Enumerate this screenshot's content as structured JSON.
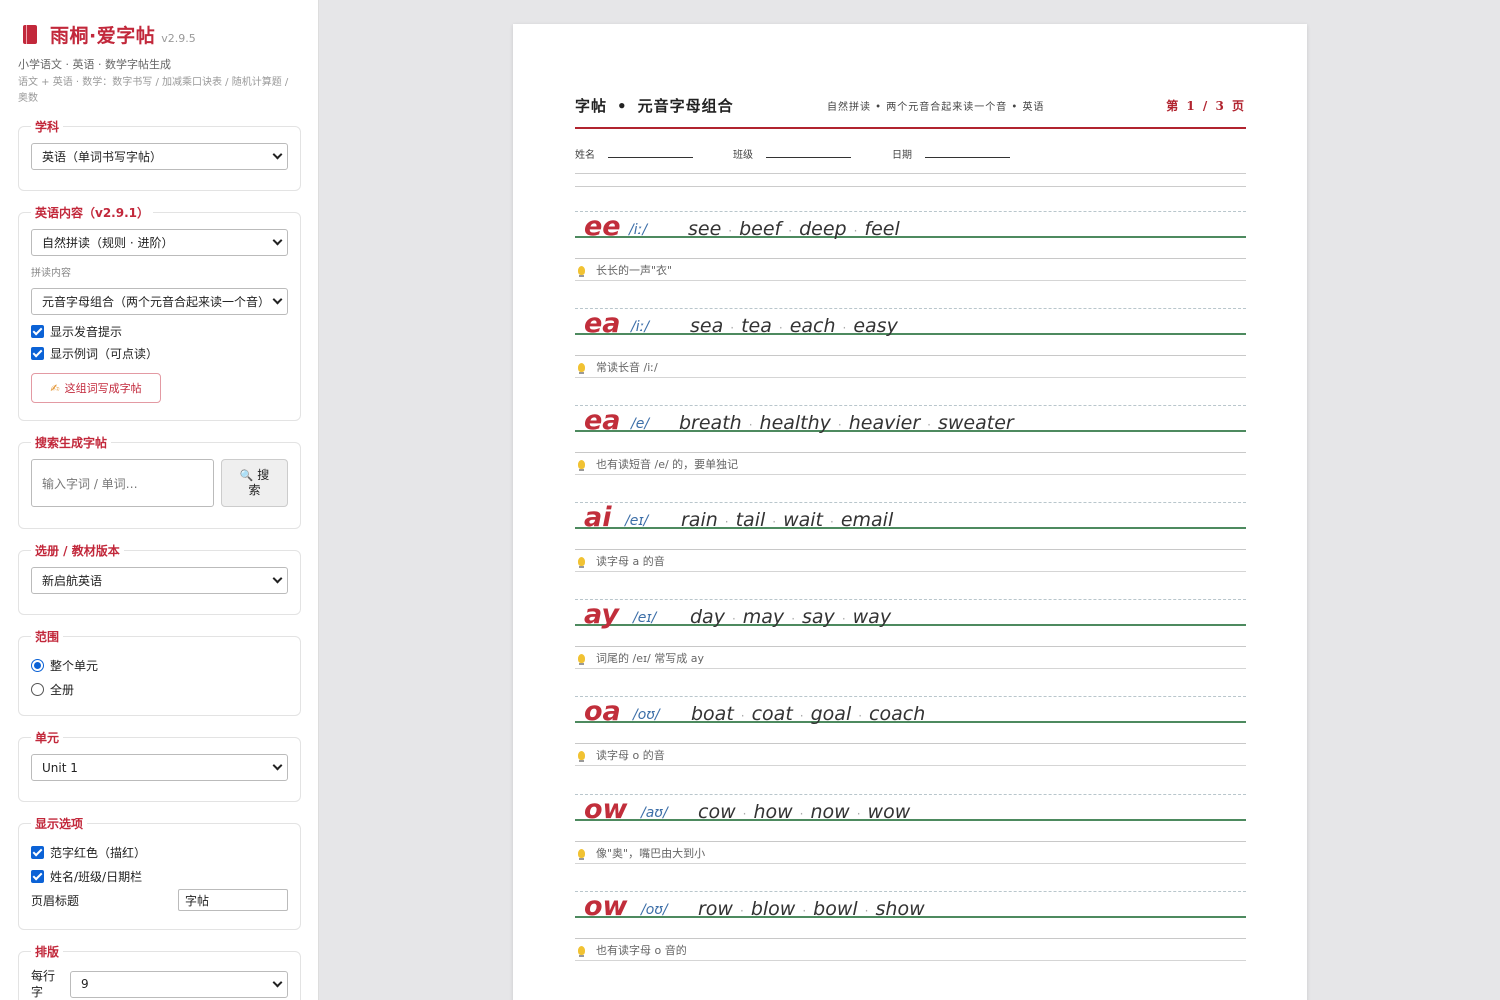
{
  "app": {
    "title": "雨桐·爱字帖",
    "version": "v2.9.5",
    "subtitle": "小学语文 · 英语 · 数学字帖生成",
    "desc": "语文 + 英语 · 数学：数字书写 / 加减乘口诀表 / 随机计算题 / 奥数"
  },
  "subject": {
    "legend": "学科",
    "value": "英语（单词书写字帖）"
  },
  "english": {
    "legend": "英语内容（v2.9.1）",
    "mode": "自然拼读（规则 · 进阶）",
    "content_label": "拼读内容",
    "content_value": "元音字母组合（两个元音合起来读一个音）",
    "show_hint": "显示发音提示",
    "show_examples": "显示例词（可点读）",
    "write_button": "这组词写成字帖"
  },
  "search": {
    "legend": "搜索生成字帖",
    "placeholder": "输入字词 / 单词…",
    "button_l1": "搜",
    "button_l2": "索"
  },
  "textbook": {
    "legend": "选册 / 教材版本",
    "value": "新启航英语"
  },
  "range": {
    "legend": "范围",
    "opt1": "整个单元",
    "opt2": "全册"
  },
  "unit": {
    "legend": "单元",
    "value": "Unit 1"
  },
  "display": {
    "legend": "显示选项",
    "red": "范字红色（描红）",
    "namebar": "姓名/班级/日期栏",
    "header_label": "页眉标题",
    "header_value": "字帖"
  },
  "layout": {
    "legend": "排版",
    "rows_label": "每行字",
    "rows_value": "9"
  },
  "paper": {
    "title": "字帖",
    "title_dot": "•",
    "subtitle": "元音字母组合",
    "mid": "自然拼读  •  两个元音合起来读一个音  •  英语",
    "page": "第 1 / 3 页",
    "name": "姓名",
    "class": "班级",
    "date": "日期"
  },
  "rows": [
    {
      "pattern": "ee",
      "ipa": "/iː/",
      "words": [
        "see",
        "beef",
        "deep",
        "feel"
      ],
      "tip": "长长的一声\"衣\""
    },
    {
      "pattern": "ea",
      "ipa": "/iː/",
      "words": [
        "sea",
        "tea",
        "each",
        "easy"
      ],
      "tip": "常读长音 /iː/"
    },
    {
      "pattern": "ea",
      "ipa": "/e/",
      "words": [
        "breath",
        "healthy",
        "heavier",
        "sweater"
      ],
      "tip": "也有读短音 /e/ 的，要单独记"
    },
    {
      "pattern": "ai",
      "ipa": "/eɪ/",
      "words": [
        "rain",
        "tail",
        "wait",
        "email"
      ],
      "tip": "读字母 a 的音"
    },
    {
      "pattern": "ay",
      "ipa": "/eɪ/",
      "words": [
        "day",
        "may",
        "say",
        "way"
      ],
      "tip": "词尾的 /eɪ/ 常写成 ay"
    },
    {
      "pattern": "oa",
      "ipa": "/oʊ/",
      "words": [
        "boat",
        "coat",
        "goal",
        "coach"
      ],
      "tip": "读字母 o 的音"
    },
    {
      "pattern": "ow",
      "ipa": "/aʊ/",
      "words": [
        "cow",
        "how",
        "now",
        "wow"
      ],
      "tip": "像\"奥\"，嘴巴由大到小"
    },
    {
      "pattern": "ow",
      "ipa": "/oʊ/",
      "words": [
        "row",
        "blow",
        "bowl",
        "show"
      ],
      "tip": "也有读字母 o 音的"
    }
  ],
  "colors": {
    "accent": "#c2283b",
    "baseline": "#4d8a5f",
    "ipa": "#3d6fa8"
  }
}
